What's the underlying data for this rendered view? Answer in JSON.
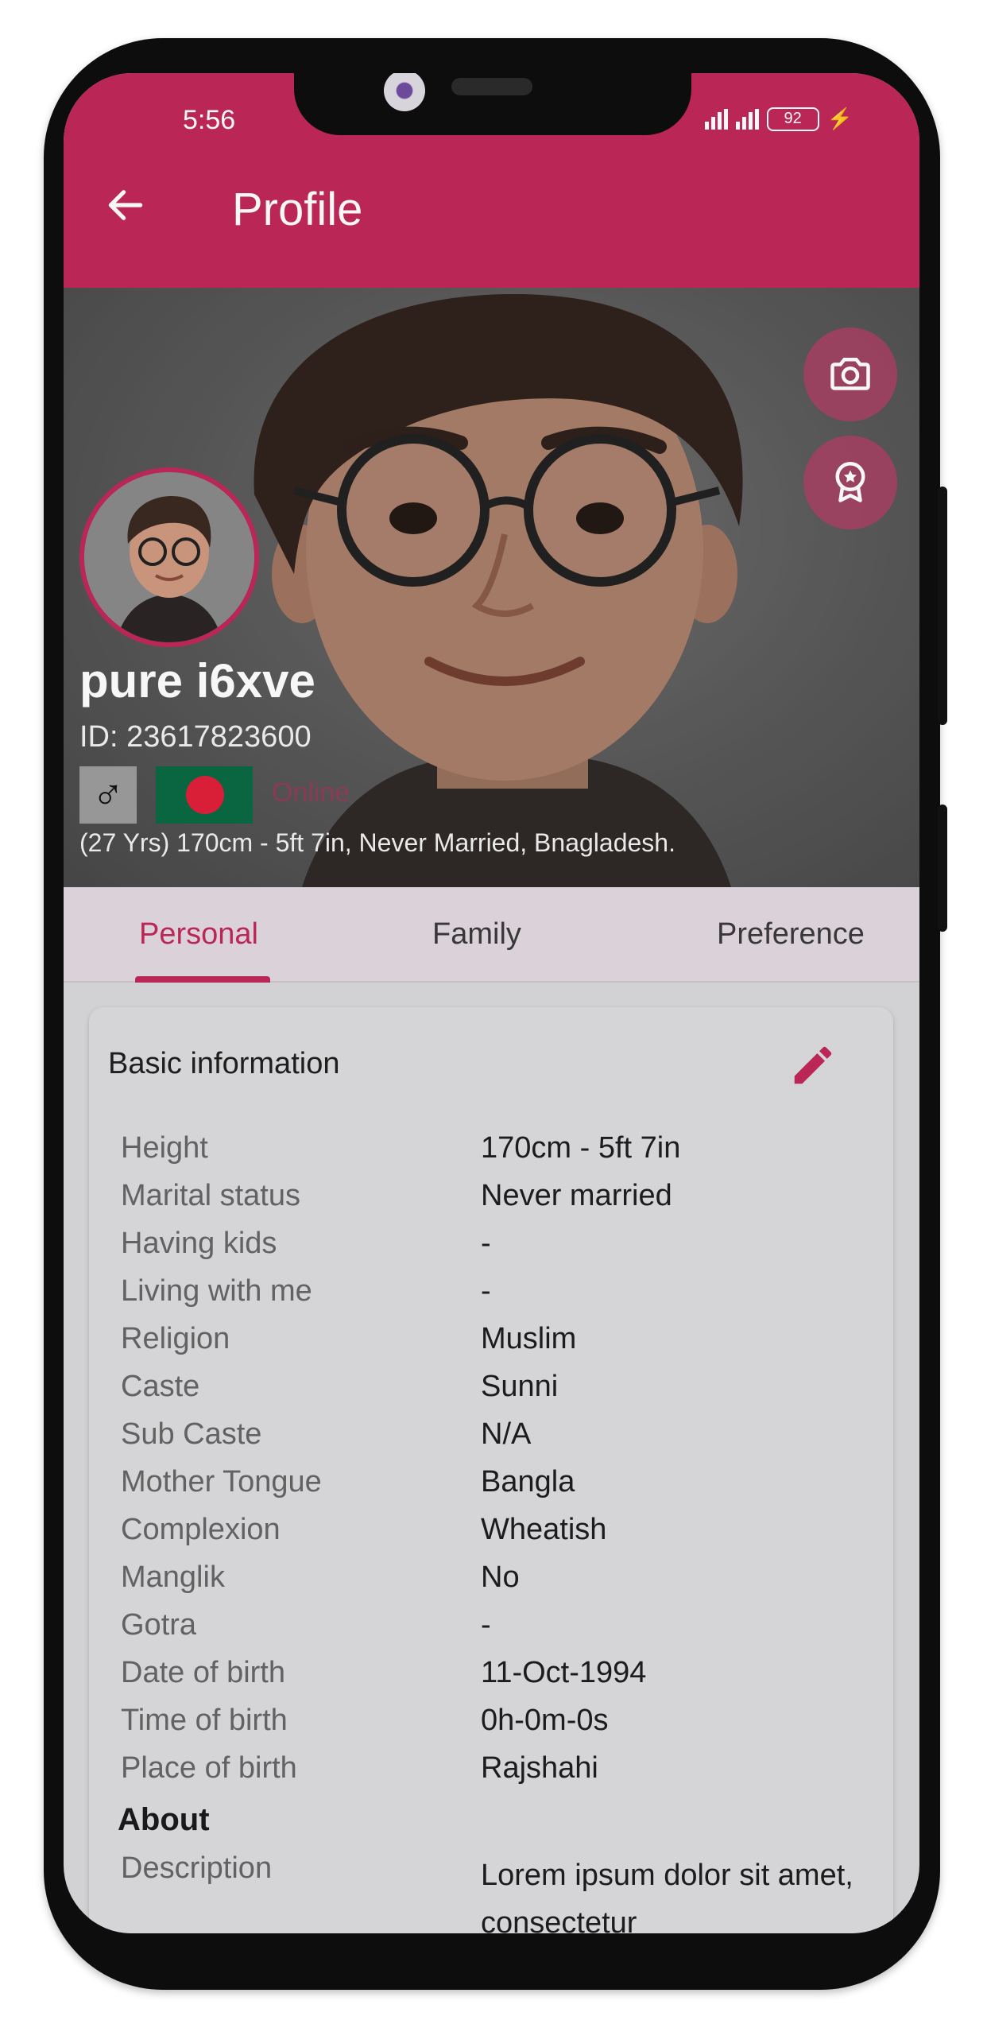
{
  "status_bar": {
    "time": "5:56",
    "battery": "92"
  },
  "app_bar": {
    "title": "Profile",
    "back_icon": "arrow-left-icon"
  },
  "profile": {
    "name": "pure i6xve",
    "id_text": "ID: 23617823600",
    "gender_symbol": "♂",
    "online_text": "Online",
    "summary": "(27 Yrs) 170cm - 5ft 7in, Never Married, Bnagladesh.",
    "flag_colors": {
      "field": "#0b6a44",
      "disc": "#e0203a"
    }
  },
  "hero_actions": {
    "camera_icon": "camera-icon",
    "badge_icon": "award-badge-icon"
  },
  "tabs": [
    {
      "label": "Personal",
      "active": true
    },
    {
      "label": "Family",
      "active": false
    },
    {
      "label": "Preference",
      "active": false
    }
  ],
  "basic_info": {
    "title": "Basic information",
    "edit_icon": "pencil-edit-icon",
    "rows": [
      {
        "label": "Height",
        "value": "170cm - 5ft 7in"
      },
      {
        "label": "Marital status",
        "value": "Never married"
      },
      {
        "label": "Having kids",
        "value": "-"
      },
      {
        "label": "Living with me",
        "value": "-"
      },
      {
        "label": "Religion",
        "value": "Muslim"
      },
      {
        "label": "Caste",
        "value": "Sunni"
      },
      {
        "label": "Sub Caste",
        "value": "N/A"
      },
      {
        "label": "Mother Tongue",
        "value": "Bangla"
      },
      {
        "label": "Complexion",
        "value": "Wheatish"
      },
      {
        "label": "Manglik",
        "value": "No"
      },
      {
        "label": "Gotra",
        "value": "-"
      },
      {
        "label": "Date of birth",
        "value": "11-Oct-1994"
      },
      {
        "label": "Time of birth",
        "value": "0h-0m-0s"
      },
      {
        "label": "Place of birth",
        "value": "Rajshahi"
      }
    ]
  },
  "about": {
    "heading": "About",
    "description_label": "Description",
    "description_value": "Lorem ipsum dolor sit amet, consectetur"
  },
  "colors": {
    "accent": "#c0295a",
    "card_bg": "#dcdbdd",
    "tab_bg": "#e3d9e1"
  }
}
